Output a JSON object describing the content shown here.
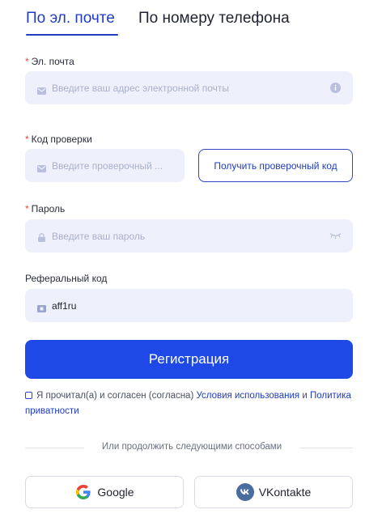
{
  "tabs": [
    {
      "label": "По эл. почте",
      "active": true
    },
    {
      "label": "По номеру телефона",
      "active": false
    }
  ],
  "email": {
    "label": "Эл. почта",
    "required_mark": "*",
    "placeholder": "Введите ваш адрес электронной почты",
    "icon": "envelope-icon",
    "info_icon": "info-icon"
  },
  "code": {
    "label": "Код проверки",
    "required_mark": "*",
    "placeholder": "Введите проверочный ...",
    "icon": "envelope-icon",
    "button_label": "Получить проверочный код"
  },
  "password": {
    "label": "Пароль",
    "required_mark": "*",
    "placeholder": "Введите ваш пароль",
    "icon": "lock-icon",
    "toggle_icon": "eye-closed-icon"
  },
  "referral": {
    "label": "Реферальный код",
    "value": "aff1ru",
    "icon": "ticket-icon"
  },
  "register_button": "Регистрация",
  "agreement": {
    "text": "Я прочитал(а) и согласен (согласна)",
    "terms_link": "Условия использования",
    "and": "и",
    "privacy_link": "Политика приватности"
  },
  "divider_text": "Или продолжить следующими способами",
  "social": [
    {
      "label": "Google",
      "icon": "google-icon"
    },
    {
      "label": "VKontakte",
      "icon": "vk-icon"
    }
  ],
  "colors": {
    "accent": "#1f3cc0",
    "primary_button": "#1e49e6",
    "field_bg": "#eef1fb",
    "required": "#e8463e"
  }
}
